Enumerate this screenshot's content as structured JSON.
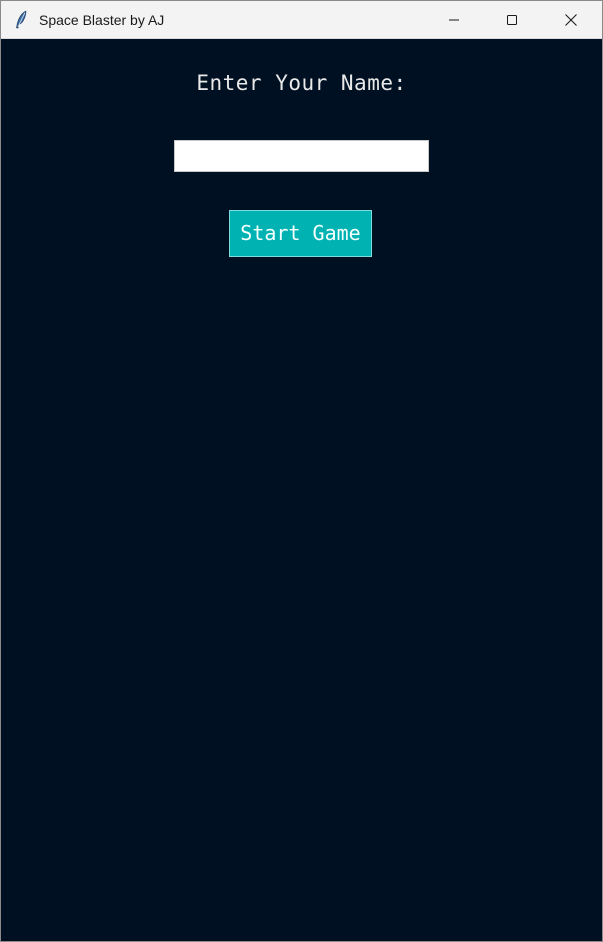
{
  "window": {
    "title": "Space Blaster by AJ",
    "app_icon": "feather-icon",
    "controls": {
      "minimize_icon": "minimize-icon",
      "maximize_icon": "maximize-icon",
      "close_icon": "close-icon"
    }
  },
  "form": {
    "prompt": "Enter Your Name:",
    "name_value": "",
    "name_placeholder": "",
    "start_button_label": "Start Game"
  },
  "colors": {
    "background": "#001023",
    "button": "#00b2b2",
    "prompt_text": "#e9e9e9"
  }
}
